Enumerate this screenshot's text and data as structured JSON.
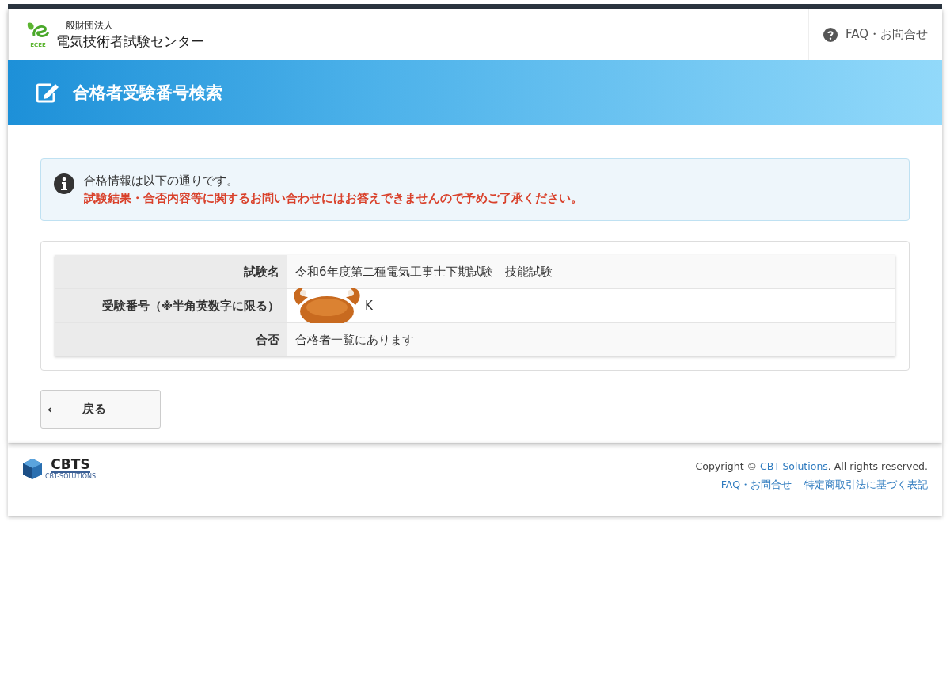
{
  "header": {
    "org_type": "一般財団法人",
    "org_name": "電気技術者試験センター",
    "logo_caption": "ECEE",
    "faq_link": "FAQ・お問合せ"
  },
  "banner": {
    "title": "合格者受験番号検索"
  },
  "notice": {
    "message": "合格情報は以下の通りです。",
    "warning": "試験結果・合否内容等に関するお問い合わせにはお答えできませんので予めご了承ください。"
  },
  "result_table": {
    "rows": [
      {
        "label": "試験名",
        "value": "令和6年度第二種電気工事士下期試験　技能試験",
        "covered": false
      },
      {
        "label": "受験番号（※半角英数字に限る）",
        "value": "K",
        "covered": true
      },
      {
        "label": "合否",
        "value": "合格者一覧にあります",
        "covered": false
      }
    ]
  },
  "back_button": {
    "label": "戻る",
    "icon": "‹"
  },
  "footer": {
    "logo_text": "CBTS",
    "logo_caption": "CBT-SOLUTIONS",
    "copyright_prefix": "Copyright © ",
    "copyright_link": "CBT-Solutions",
    "copyright_suffix": ". All rights reserved.",
    "links": [
      "FAQ・お問合せ",
      "特定商取引法に基づく表記"
    ]
  }
}
